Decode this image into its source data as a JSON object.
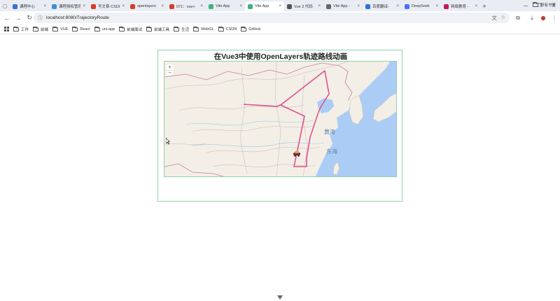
{
  "browser": {
    "tabs": [
      {
        "label": "课程中心",
        "favicon_color": "#3b6fd8"
      },
      {
        "label": "课程授权管理",
        "favicon_color": "#3b8fd8"
      },
      {
        "label": "写文章-CSDN",
        "favicon_color": "#d63c2f"
      },
      {
        "label": "openlayers",
        "favicon_color": "#d63c2f"
      },
      {
        "label": "071：vue+",
        "favicon_color": "#d63c2f"
      },
      {
        "label": "Vite App",
        "favicon_color": "#3fb27f"
      },
      {
        "label": "Vite App",
        "favicon_color": "#3fb27f"
      },
      {
        "label": "Vue 3 代码",
        "favicon_color": "#555555"
      },
      {
        "label": "Vite App - ",
        "favicon_color": "#666666"
      },
      {
        "label": "百度翻译-",
        "favicon_color": "#2f6fd8"
      },
      {
        "label": "DeepSeek",
        "favicon_color": "#4d6bfe"
      },
      {
        "label": "网络教育 - ",
        "favicon_color": "#c2185b"
      }
    ],
    "active_tab_index": 6,
    "url": "localhost:8080/TrajectoryRoute",
    "bookmarks": [
      "工作",
      "前端",
      "VUE",
      "React",
      "uni-app",
      "前端面试",
      "前端工具",
      "生活",
      "WebGL",
      "CSDN",
      "GitHub"
    ],
    "all_bookmarks_label": "所有书签"
  },
  "page": {
    "title": "在Vue3中使用OpenLayers轨迹路线动画"
  },
  "map": {
    "zoom_in": "+",
    "zoom_out": "−",
    "labels": {
      "yellow_sea": "黄海",
      "east_sea": "东海"
    },
    "route_color": "#e0508f",
    "ocean_color": "#abcdf5",
    "land_color": "#f3efe6"
  }
}
